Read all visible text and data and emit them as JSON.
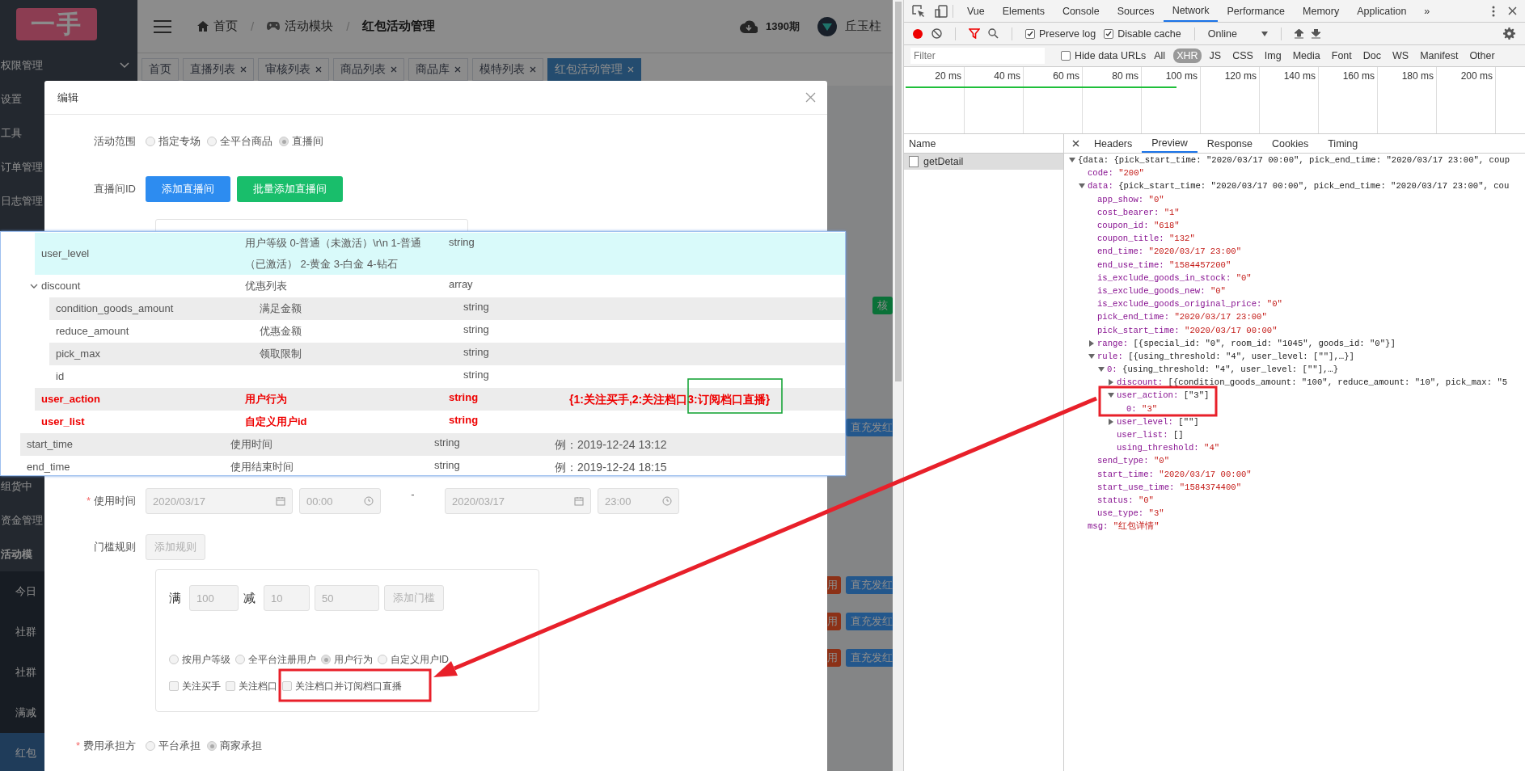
{
  "sidebar": {
    "logo": "一手",
    "items": [
      {
        "label": "权限管理",
        "kind": "submenu"
      },
      {
        "label": "设置",
        "kind": "item"
      },
      {
        "label": "工具",
        "kind": "item"
      },
      {
        "label": "订单管理",
        "kind": "item"
      },
      {
        "label": "日志管理",
        "kind": "item"
      }
    ],
    "lower_items": [
      {
        "label": "组货中"
      },
      {
        "label": "资金管理"
      },
      {
        "label": "活动模",
        "children": [
          {
            "label": "今日",
            "selected": false
          },
          {
            "label": "社群",
            "selected": false
          },
          {
            "label": "社群",
            "selected": false
          },
          {
            "label": "满减",
            "selected": false
          },
          {
            "label": "红包",
            "selected": true
          }
        ]
      }
    ]
  },
  "header": {
    "separator": "/",
    "breadcrumb": [
      {
        "label": "首页",
        "current": false
      },
      {
        "label": "活动模块",
        "current": false
      },
      {
        "label": "红包活动管理",
        "current": true
      }
    ],
    "issue": "1390期",
    "user": "丘玉柱"
  },
  "tabs": [
    {
      "label": "首页",
      "closable": false,
      "selected": false
    },
    {
      "label": "直播列表",
      "closable": true,
      "selected": false
    },
    {
      "label": "审核列表",
      "closable": true,
      "selected": false
    },
    {
      "label": "商品列表",
      "closable": true,
      "selected": false
    },
    {
      "label": "商品库",
      "closable": true,
      "selected": false
    },
    {
      "label": "模特列表",
      "closable": true,
      "selected": false
    },
    {
      "label": "红包活动管理",
      "closable": true,
      "selected": true
    }
  ],
  "background_rows": [
    {
      "buttons": [
        {
          "kind": "success",
          "label": "核"
        }
      ]
    },
    {
      "buttons": [
        {
          "kind": "primary",
          "label": "直充发红"
        }
      ]
    },
    {
      "buttons": [
        {
          "kind": "danger",
          "label": "用"
        },
        {
          "kind": "primary",
          "label": "直充发红"
        }
      ]
    },
    {
      "buttons": [
        {
          "kind": "danger",
          "label": "用"
        },
        {
          "kind": "primary",
          "label": "直充发红"
        }
      ]
    },
    {
      "buttons": [
        {
          "kind": "danger",
          "label": "用"
        },
        {
          "kind": "primary",
          "label": "直充发红"
        }
      ]
    }
  ],
  "modal": {
    "title": "编辑",
    "scope": {
      "label": "活动范围",
      "options": [
        {
          "label": "指定专场",
          "selected": false
        },
        {
          "label": "全平台商品",
          "selected": false
        },
        {
          "label": "直播间",
          "selected": true
        }
      ]
    },
    "room": {
      "label": "直播间ID",
      "buttons": [
        {
          "label": "添加直播间",
          "kind": "primary"
        },
        {
          "label": "批量添加直播间",
          "kind": "success"
        }
      ]
    },
    "use_time": {
      "label": "使用时间",
      "required_mark": "*",
      "disabled": true,
      "start_date": "2020/03/17",
      "start_time": "00:00",
      "separator": "-",
      "end_date": "2020/03/17",
      "end_time": "23:00"
    },
    "threshold": {
      "label": "门槛规则",
      "disabled": true,
      "button": "添加规则",
      "full_label": "满",
      "full_value": "100",
      "minus_label": "减",
      "minus_value": "10",
      "limit_value": "50",
      "add_button": "添加门槛",
      "targets": [
        {
          "label": "按用户等级",
          "selected": false
        },
        {
          "label": "全平台注册用户",
          "selected": false
        },
        {
          "label": "用户行为",
          "selected": true
        },
        {
          "label": "自定义用户ID",
          "selected": false
        }
      ],
      "actions": [
        {
          "label": "关注买手",
          "checked": false
        },
        {
          "label": "关注档口",
          "checked": false
        },
        {
          "label": "关注档口并订阅档口直播",
          "checked": false
        }
      ]
    },
    "cost": {
      "label": "费用承担方",
      "required_mark": "*",
      "options": [
        {
          "label": "平台承担",
          "selected": false
        },
        {
          "label": "商家承担",
          "selected": true
        }
      ]
    }
  },
  "doc_table": {
    "nested_rows": [
      {
        "name": "user_level",
        "description": "用户等级 0-普通（未激活）\\r\\n 1-普通（已激活） 2-黄金 3-白金 4-钻石",
        "type": "string",
        "highlighted": false,
        "selected": true
      },
      {
        "name": "discount",
        "description": "优惠列表",
        "type": "array",
        "highlighted": false,
        "selected": false,
        "expanded": true,
        "children": [
          {
            "name": "condition_goods_amount",
            "description": "满足金额",
            "type": "string",
            "highlighted": false,
            "selected": false
          },
          {
            "name": "reduce_amount",
            "description": "优惠金额",
            "type": "string",
            "highlighted": false,
            "selected": false
          },
          {
            "name": "pick_max",
            "description": "领取限制",
            "type": "string",
            "highlighted": false,
            "selected": false
          },
          {
            "name": "id",
            "type": "string",
            "highlighted": false,
            "selected": false
          }
        ]
      },
      {
        "name": "user_action",
        "description": "用户行为",
        "type": "string",
        "note": "{1:关注买手,2:关注档口3:订阅档口直播}",
        "highlighted": true,
        "selected": false
      },
      {
        "name": "user_list",
        "description": "自定义用户id",
        "type": "string",
        "highlighted": true,
        "selected": false
      }
    ],
    "rows": [
      {
        "name": "start_time",
        "description": "使用时间",
        "type": "string",
        "note": "例：2019-12-24 13:12",
        "highlighted": false,
        "selected": false
      },
      {
        "name": "end_time",
        "description": "使用结束时间",
        "type": "string",
        "note": "例：2019-12-24 18:15",
        "highlighted": false,
        "selected": false
      }
    ]
  },
  "devtools": {
    "tabs": [
      {
        "label": "Vue",
        "selected": false
      },
      {
        "label": "Elements",
        "selected": false
      },
      {
        "label": "Console",
        "selected": false
      },
      {
        "label": "Sources",
        "selected": false
      },
      {
        "label": "Network",
        "selected": true
      },
      {
        "label": "Performance",
        "selected": false
      },
      {
        "label": "Memory",
        "selected": false
      },
      {
        "label": "Application",
        "selected": false
      }
    ],
    "more": "»",
    "preserve_log": {
      "label": "Preserve log",
      "checked": true
    },
    "disable_cache": {
      "label": "Disable cache",
      "checked": true
    },
    "throttle": "Online",
    "filter": {
      "placeholder": "Filter",
      "hide_data_urls": {
        "label": "Hide data URLs",
        "checked": false
      },
      "types": [
        {
          "label": "All",
          "selected": false
        },
        {
          "label": "XHR",
          "selected": true
        },
        {
          "label": "JS",
          "selected": false
        },
        {
          "label": "CSS",
          "selected": false
        },
        {
          "label": "Img",
          "selected": false
        },
        {
          "label": "Media",
          "selected": false
        },
        {
          "label": "Font",
          "selected": false
        },
        {
          "label": "Doc",
          "selected": false
        },
        {
          "label": "WS",
          "selected": false
        },
        {
          "label": "Manifest",
          "selected": false
        },
        {
          "label": "Other",
          "selected": false
        }
      ]
    },
    "timeline_ticks": [
      "20 ms",
      "40 ms",
      "60 ms",
      "80 ms",
      "100 ms",
      "120 ms",
      "140 ms",
      "160 ms",
      "180 ms",
      "200 ms"
    ],
    "name_header": "Name",
    "requests": [
      {
        "name": "getDetail",
        "selected": true
      }
    ],
    "detail_tabs": [
      {
        "label": "Headers",
        "selected": false
      },
      {
        "label": "Preview",
        "selected": true
      },
      {
        "label": "Response",
        "selected": false
      },
      {
        "label": "Cookies",
        "selected": false
      },
      {
        "label": "Timing",
        "selected": false
      }
    ],
    "preview": [
      {
        "value": "{data: {pick_start_time: \"2020/03/17 00:00\", pick_end_time: \"2020/03/17 23:00\", coup",
        "kind": "summary",
        "expanded": true,
        "children": [
          {
            "key": "code:",
            "value": "\"200\"",
            "kind": "string"
          },
          {
            "key": "data:",
            "value": "{pick_start_time: \"2020/03/17 00:00\", pick_end_time: \"2020/03/17 23:00\", cou",
            "kind": "summary",
            "expanded": true,
            "children": [
              {
                "key": "app_show:",
                "value": "\"0\"",
                "kind": "string"
              },
              {
                "key": "cost_bearer:",
                "value": "\"1\"",
                "kind": "string"
              },
              {
                "key": "coupon_id:",
                "value": "\"618\"",
                "kind": "string"
              },
              {
                "key": "coupon_title:",
                "value": "\"132\"",
                "kind": "string"
              },
              {
                "key": "end_time:",
                "value": "\"2020/03/17 23:00\"",
                "kind": "string"
              },
              {
                "key": "end_use_time:",
                "value": "\"1584457200\"",
                "kind": "string"
              },
              {
                "key": "is_exclude_goods_in_stock:",
                "value": "\"0\"",
                "kind": "string"
              },
              {
                "key": "is_exclude_goods_new:",
                "value": "\"0\"",
                "kind": "string"
              },
              {
                "key": "is_exclude_goods_original_price:",
                "value": "\"0\"",
                "kind": "string"
              },
              {
                "key": "pick_end_time:",
                "value": "\"2020/03/17 23:00\"",
                "kind": "string"
              },
              {
                "key": "pick_start_time:",
                "value": "\"2020/03/17 00:00\"",
                "kind": "string"
              },
              {
                "key": "range:",
                "value": "[{special_id: \"0\", room_id: \"1045\", goods_id: \"0\"}]",
                "kind": "summary",
                "expanded": false
              },
              {
                "key": "rule:",
                "value": "[{using_threshold: \"4\", user_level: [\"\"],…}]",
                "kind": "summary",
                "expanded": true,
                "children": [
                  {
                    "key": "0:",
                    "value": "{using_threshold: \"4\", user_level: [\"\"],…}",
                    "kind": "summary",
                    "expanded": true,
                    "children": [
                      {
                        "key": "discount:",
                        "value": "[{condition_goods_amount: \"100\", reduce_amount: \"10\", pick_max: \"5",
                        "kind": "summary",
                        "expanded": false
                      },
                      {
                        "key": "user_action:",
                        "value": "[\"3\"]",
                        "kind": "summary",
                        "expanded": true,
                        "children": [
                          {
                            "key": "0:",
                            "value": "\"3\"",
                            "kind": "string"
                          }
                        ]
                      },
                      {
                        "key": "user_level:",
                        "value": "[\"\"]",
                        "kind": "summary",
                        "expanded": false
                      },
                      {
                        "key": "user_list:",
                        "value": "[]",
                        "kind": "summary"
                      },
                      {
                        "key": "using_threshold:",
                        "value": "\"4\"",
                        "kind": "string"
                      }
                    ]
                  }
                ]
              },
              {
                "key": "send_type:",
                "value": "\"0\"",
                "kind": "string"
              },
              {
                "key": "start_time:",
                "value": "\"2020/03/17 00:00\"",
                "kind": "string"
              },
              {
                "key": "start_use_time:",
                "value": "\"1584374400\"",
                "kind": "string"
              },
              {
                "key": "status:",
                "value": "\"0\"",
                "kind": "string"
              },
              {
                "key": "use_type:",
                "value": "\"3\"",
                "kind": "string"
              }
            ]
          },
          {
            "key": "msg:",
            "value": "\"红包详情\"",
            "kind": "string"
          }
        ]
      }
    ]
  }
}
